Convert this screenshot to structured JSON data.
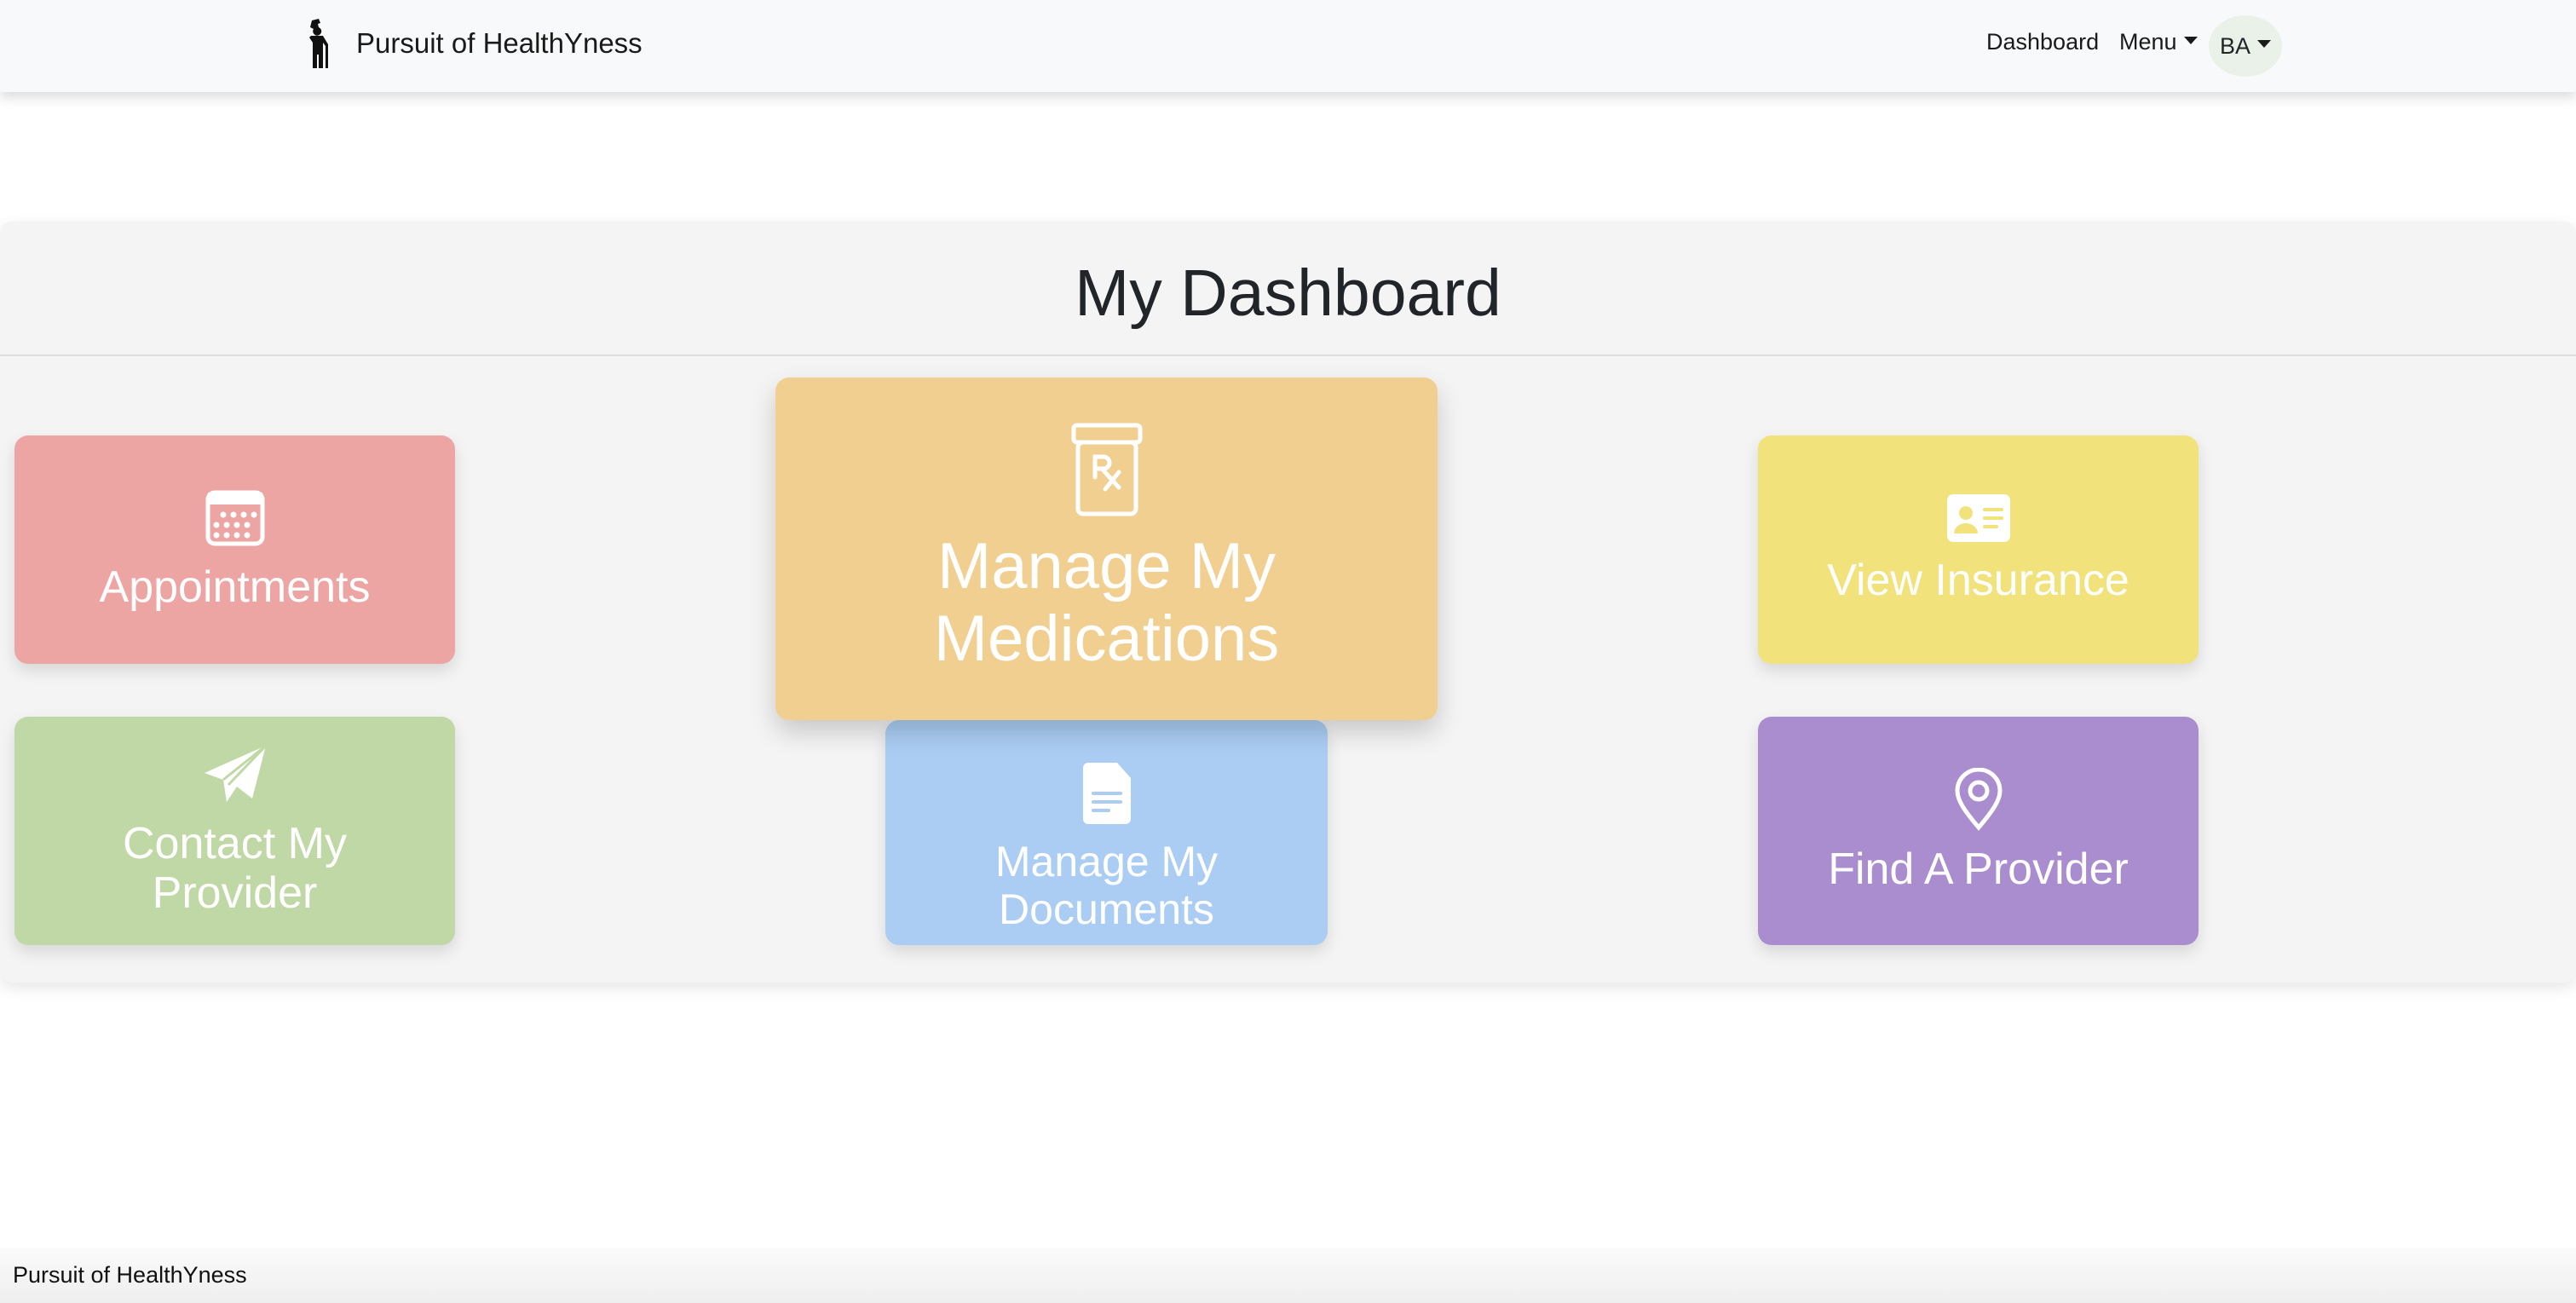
{
  "navbar": {
    "brand": "Pursuit of HealthYness",
    "links": {
      "dashboard": "Dashboard",
      "menu": "Menu",
      "user": "BA"
    }
  },
  "page": {
    "title": "My Dashboard"
  },
  "cards": {
    "appointments": {
      "label": "Appointments",
      "color": "#eca5a3"
    },
    "medications": {
      "label": "Manage My Medications",
      "color": "#f0cf91"
    },
    "insurance": {
      "label": "View Insurance",
      "color": "#f1e27b"
    },
    "contact": {
      "label": "Contact My Provider",
      "color": "#c0d8a5"
    },
    "documents": {
      "label": "Manage My Documents",
      "color": "#abcdf4"
    },
    "find_provider": {
      "label": "Find A Provider",
      "color": "#a98dcf"
    }
  },
  "footer": {
    "text": "Pursuit of HealthYness"
  }
}
